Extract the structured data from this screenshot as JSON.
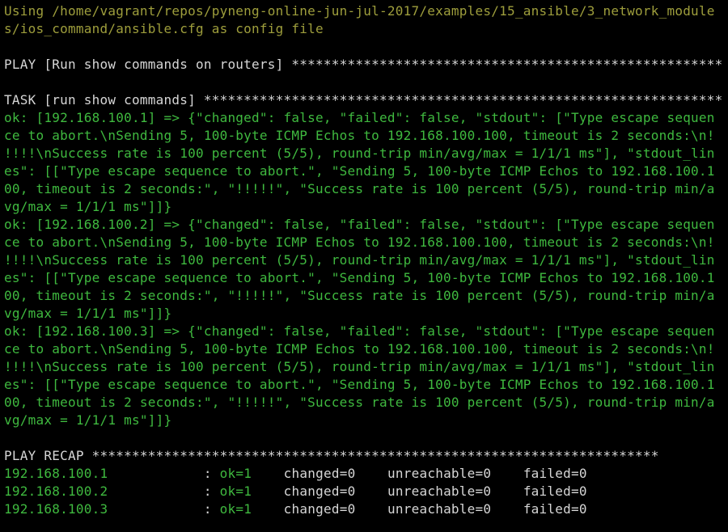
{
  "terminal": {
    "top_clipped_fragment": "                    ____   ___  ____   ____   _______   _____",
    "config_lines": [
      "Using /home/vagrant/repos/pyneng-online-jun-jul-2017/examples/15_ansible/3_network_module",
      "s/ios_command/ansible.cfg as config file"
    ],
    "play_line": "PLAY [Run show commands on routers] ******************************************************",
    "task_line": "TASK [run show commands] *****************************************************************",
    "ok_lines": [
      "ok: [192.168.100.1] => {\"changed\": false, \"failed\": false, \"stdout\": [\"Type escape sequen",
      "ce to abort.\\nSending 5, 100-byte ICMP Echos to 192.168.100.100, timeout is 2 seconds:\\n!",
      "!!!!\\nSuccess rate is 100 percent (5/5), round-trip min/avg/max = 1/1/1 ms\"], \"stdout_lin",
      "es\": [[\"Type escape sequence to abort.\", \"Sending 5, 100-byte ICMP Echos to 192.168.100.1",
      "00, timeout is 2 seconds:\", \"!!!!!\", \"Success rate is 100 percent (5/5), round-trip min/a",
      "vg/max = 1/1/1 ms\"]]}",
      "ok: [192.168.100.2] => {\"changed\": false, \"failed\": false, \"stdout\": [\"Type escape sequen",
      "ce to abort.\\nSending 5, 100-byte ICMP Echos to 192.168.100.100, timeout is 2 seconds:\\n!",
      "!!!!\\nSuccess rate is 100 percent (5/5), round-trip min/avg/max = 1/1/1 ms\"], \"stdout_lin",
      "es\": [[\"Type escape sequence to abort.\", \"Sending 5, 100-byte ICMP Echos to 192.168.100.1",
      "00, timeout is 2 seconds:\", \"!!!!!\", \"Success rate is 100 percent (5/5), round-trip min/a",
      "vg/max = 1/1/1 ms\"]]}",
      "ok: [192.168.100.3] => {\"changed\": false, \"failed\": false, \"stdout\": [\"Type escape sequen",
      "ce to abort.\\nSending 5, 100-byte ICMP Echos to 192.168.100.100, timeout is 2 seconds:\\n!",
      "!!!!\\nSuccess rate is 100 percent (5/5), round-trip min/avg/max = 1/1/1 ms\"], \"stdout_lin",
      "es\": [[\"Type escape sequence to abort.\", \"Sending 5, 100-byte ICMP Echos to 192.168.100.1",
      "00, timeout is 2 seconds:\", \"!!!!!\", \"Success rate is 100 percent (5/5), round-trip min/a",
      "vg/max = 1/1/1 ms\"]]}"
    ],
    "recap_header": "PLAY RECAP ***********************************************************************",
    "recap_rows": [
      {
        "host": "192.168.100.1",
        "sep": "            : ",
        "ok": "ok=1",
        "gap1": "    ",
        "changed": "changed=0",
        "gap2": "    ",
        "unreachable": "unreachable=0",
        "gap3": "    ",
        "failed": "failed=0"
      },
      {
        "host": "192.168.100.2",
        "sep": "            : ",
        "ok": "ok=1",
        "gap1": "    ",
        "changed": "changed=0",
        "gap2": "    ",
        "unreachable": "unreachable=0",
        "gap3": "    ",
        "failed": "failed=0"
      },
      {
        "host": "192.168.100.3",
        "sep": "            : ",
        "ok": "ok=1",
        "gap1": "    ",
        "changed": "changed=0",
        "gap2": "    ",
        "unreachable": "unreachable=0",
        "gap3": "    ",
        "failed": "failed=0"
      }
    ],
    "colors": {
      "background": "#000000",
      "warning": "#9e9e3c",
      "default": "#d6d6d6",
      "ok": "#3fb93f"
    }
  }
}
